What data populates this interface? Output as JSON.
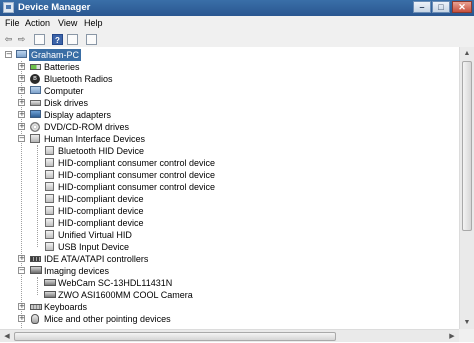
{
  "window": {
    "title": "Device Manager",
    "minimize_label": "–",
    "maximize_label": "□",
    "close_label": "✕"
  },
  "menu": [
    {
      "label": "File"
    },
    {
      "label": "Action"
    },
    {
      "label": "View"
    },
    {
      "label": "Help"
    }
  ],
  "toolbar": {
    "buttons": [
      {
        "icon": "back-arrow-icon",
        "glyph": "⇦"
      },
      {
        "icon": "forward-arrow-icon",
        "glyph": "⇨"
      },
      {
        "icon": "properties-icon",
        "glyph": ""
      },
      {
        "icon": "help-icon",
        "glyph": "?"
      },
      {
        "icon": "update-driver-icon",
        "glyph": ""
      },
      {
        "icon": "scan-hardware-icon",
        "glyph": ""
      }
    ]
  },
  "tree": {
    "root": {
      "label": "Graham-PC",
      "expander": "−",
      "icon": "computer-icon"
    },
    "items": [
      {
        "label": "Batteries",
        "level": 1,
        "expander": "+",
        "icon": "battery-icon"
      },
      {
        "label": "Bluetooth Radios",
        "level": 1,
        "expander": "+",
        "icon": "bluetooth-icon"
      },
      {
        "label": "Computer",
        "level": 1,
        "expander": "+",
        "icon": "computer-icon"
      },
      {
        "label": "Disk drives",
        "level": 1,
        "expander": "+",
        "icon": "disk-drive-icon"
      },
      {
        "label": "Display adapters",
        "level": 1,
        "expander": "+",
        "icon": "display-adapter-icon"
      },
      {
        "label": "DVD/CD-ROM drives",
        "level": 1,
        "expander": "+",
        "icon": "dvd-drive-icon"
      },
      {
        "label": "Human Interface Devices",
        "level": 1,
        "expander": "−",
        "icon": "hid-icon"
      },
      {
        "label": "Bluetooth HID Device",
        "level": 2,
        "expander": "",
        "icon": "hid-device-icon"
      },
      {
        "label": "HID-compliant consumer control device",
        "level": 2,
        "expander": "",
        "icon": "hid-device-icon"
      },
      {
        "label": "HID-compliant consumer control device",
        "level": 2,
        "expander": "",
        "icon": "hid-device-icon"
      },
      {
        "label": "HID-compliant consumer control device",
        "level": 2,
        "expander": "",
        "icon": "hid-device-icon"
      },
      {
        "label": "HID-compliant device",
        "level": 2,
        "expander": "",
        "icon": "hid-device-icon"
      },
      {
        "label": "HID-compliant device",
        "level": 2,
        "expander": "",
        "icon": "hid-device-icon"
      },
      {
        "label": "HID-compliant device",
        "level": 2,
        "expander": "",
        "icon": "hid-device-icon"
      },
      {
        "label": "Unified Virtual HID",
        "level": 2,
        "expander": "",
        "icon": "hid-device-icon"
      },
      {
        "label": "USB Input Device",
        "level": 2,
        "expander": "",
        "icon": "hid-device-icon"
      },
      {
        "label": "IDE ATA/ATAPI controllers",
        "level": 1,
        "expander": "+",
        "icon": "ide-controller-icon"
      },
      {
        "label": "Imaging devices",
        "level": 1,
        "expander": "−",
        "icon": "imaging-device-icon"
      },
      {
        "label": "WebCam SC-13HDL11431N",
        "level": 2,
        "expander": "",
        "icon": "webcam-icon"
      },
      {
        "label": "ZWO ASI1600MM COOL Camera",
        "level": 2,
        "expander": "",
        "icon": "camera-icon"
      },
      {
        "label": "Keyboards",
        "level": 1,
        "expander": "+",
        "icon": "keyboard-icon"
      },
      {
        "label": "Mice and other pointing devices",
        "level": 1,
        "expander": "+",
        "icon": "mouse-icon"
      }
    ]
  },
  "scrollbars": {
    "up": "▲",
    "down": "▼",
    "left": "◀",
    "right": "▶"
  }
}
